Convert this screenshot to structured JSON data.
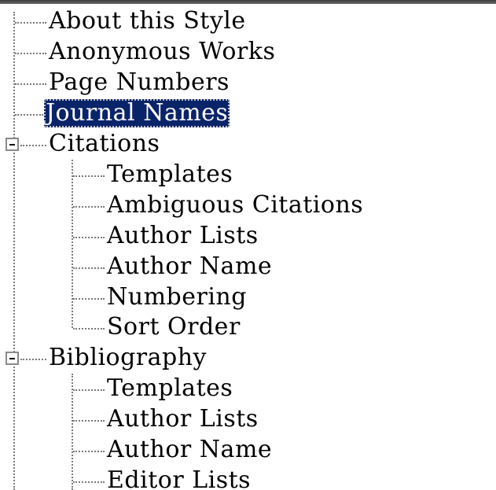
{
  "tree": {
    "selected_color": "#0a246a",
    "items": [
      {
        "label": "About this Style"
      },
      {
        "label": "Anonymous Works"
      },
      {
        "label": "Page Numbers"
      },
      {
        "label": "Journal Names",
        "selected": true
      },
      {
        "label": "Citations",
        "expanded": true,
        "children": [
          {
            "label": "Templates"
          },
          {
            "label": "Ambiguous Citations"
          },
          {
            "label": "Author Lists"
          },
          {
            "label": "Author Name"
          },
          {
            "label": "Numbering"
          },
          {
            "label": "Sort Order"
          }
        ]
      },
      {
        "label": "Bibliography",
        "expanded": true,
        "children": [
          {
            "label": "Templates"
          },
          {
            "label": "Author Lists"
          },
          {
            "label": "Author Name"
          },
          {
            "label": "Editor Lists"
          }
        ]
      }
    ]
  },
  "icons": {
    "collapse": "minus-box-icon"
  }
}
